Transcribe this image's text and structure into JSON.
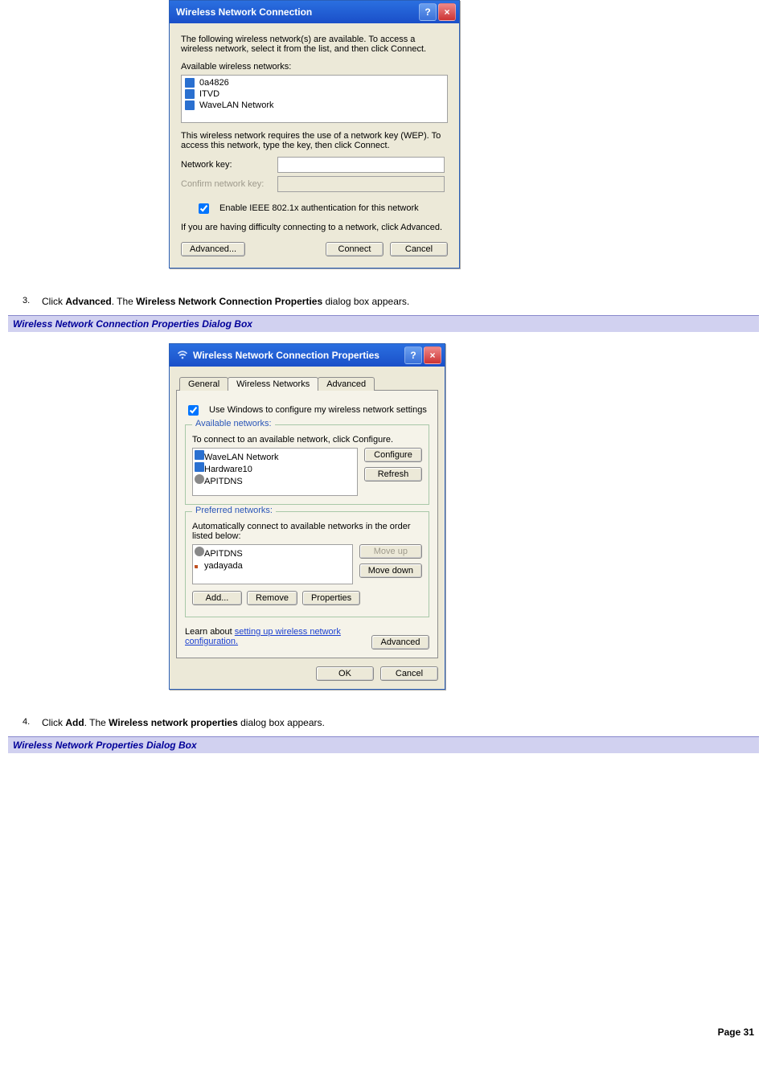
{
  "dialog1": {
    "title": "Wireless Network Connection",
    "intro": "The following wireless network(s) are available. To access a wireless network, select it from the list, and then click Connect.",
    "available_label": "Available wireless networks:",
    "networks": [
      "0a4826",
      "ITVD",
      "WaveLAN Network"
    ],
    "wep_text": "This wireless network requires the use of a network key (WEP). To access this network, type the key, then click Connect.",
    "key_label": "Network key:",
    "confirm_key_label": "Confirm network key:",
    "enable_8021x_label": "Enable IEEE 802.1x authentication for this network",
    "help_text": "If you are having difficulty connecting to a network, click Advanced.",
    "buttons": {
      "advanced": "Advanced...",
      "connect": "Connect",
      "cancel": "Cancel"
    }
  },
  "steps": {
    "s3_prefix": "Click ",
    "s3_bold1": "Advanced",
    "s3_mid": ". The ",
    "s3_bold2": "Wireless Network Connection Properties",
    "s3_suffix": " dialog box appears.",
    "s4_prefix": "Click ",
    "s4_bold1": "Add",
    "s4_mid": ". The ",
    "s4_bold2": "Wireless network properties",
    "s4_suffix": " dialog box appears."
  },
  "heading1": "Wireless Network Connection Properties Dialog Box",
  "dialog2": {
    "title": "Wireless Network Connection Properties",
    "tabs": {
      "general": "General",
      "wireless": "Wireless Networks",
      "advanced": "Advanced"
    },
    "use_windows_label": "Use Windows to configure my wireless network settings",
    "available": {
      "legend": "Available networks:",
      "instruction": "To connect to an available network, click Configure.",
      "items": [
        "WaveLAN Network",
        "Hardware10",
        "APITDNS"
      ],
      "buttons": {
        "configure": "Configure",
        "refresh": "Refresh"
      }
    },
    "preferred": {
      "legend": "Preferred networks:",
      "instruction": "Automatically connect to available networks in the order listed below:",
      "items": [
        "APITDNS",
        "yadayada"
      ],
      "buttons": {
        "moveup": "Move up",
        "movedown": "Move down",
        "add": "Add...",
        "remove": "Remove",
        "properties": "Properties"
      }
    },
    "learn_pre": "Learn about ",
    "learn_link": "setting up wireless network configuration.",
    "advanced_btn": "Advanced",
    "ok": "OK",
    "cancel": "Cancel"
  },
  "heading2": "Wireless Network Properties Dialog Box",
  "page_number": "Page 31"
}
